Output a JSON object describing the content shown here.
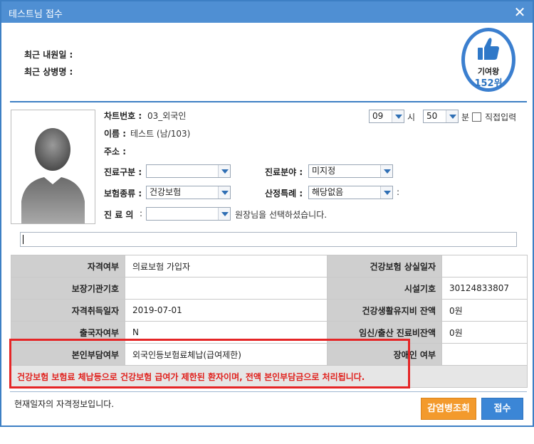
{
  "window": {
    "title": "테스트님 접수"
  },
  "recent": {
    "visit_label": "최근 내원일 :",
    "disease_label": "최근 상병명 :"
  },
  "badge": {
    "line1": "기여왕",
    "line2": "152위"
  },
  "patient": {
    "chart_label": "차트번호 :",
    "chart_value": "03_외국인",
    "name_label": "이름 :",
    "name_value": "테스트 (남/103)",
    "address_label": "주소 :"
  },
  "time": {
    "hour": "09",
    "hour_unit": "시",
    "minute": "50",
    "minute_unit": "분",
    "manual_label": "직접입력"
  },
  "form": {
    "visit_type_label": "진료구분 :",
    "visit_type_value": "",
    "department_label": "진료분야 :",
    "department_value": "미지정",
    "insurance_label": "보험종류 :",
    "insurance_value": "건강보험",
    "special_label": "산정특례 :",
    "special_value": "해당없음",
    "special_suffix": ":",
    "doctor_label": "진 료 의",
    "doctor_colon": ":",
    "doctor_value": "",
    "doctor_hint": "원장님을 선택하셨습니다."
  },
  "memo": {
    "value": ""
  },
  "table": {
    "rows": [
      {
        "k1": "자격여부",
        "v1": "의료보험 가입자",
        "k2": "건강보험 상실일자",
        "v2": ""
      },
      {
        "k1": "보장기관기호",
        "v1": "",
        "k2": "시설기호",
        "v2": "30124833807"
      },
      {
        "k1": "자격취득일자",
        "v1": "2019-07-01",
        "k2": "건강생활유지비 잔액",
        "v2": "0원"
      },
      {
        "k1": "출국자여부",
        "v1": "N",
        "k2": "임신/출산 진료비잔액",
        "v2": "0원"
      },
      {
        "k1": "본인부담여부",
        "v1": "외국인등보험료체납(급여제한)",
        "k2": "장애인 여부",
        "v2": ""
      }
    ],
    "warning": "건강보험 보험료 체납등으로 건강보험 급여가 제한된 환자이며, 전액 본인부담금으로 처리됩니다."
  },
  "footer": {
    "status": "현재일자의 자격정보입니다.",
    "lookup_button": "감염병조회",
    "submit_button": "접수"
  },
  "colors": {
    "title_bar": "#4f8fd3",
    "warning_text": "#e0211d",
    "lookup_button": "#f39a2c",
    "submit_button": "#3b86d6"
  }
}
